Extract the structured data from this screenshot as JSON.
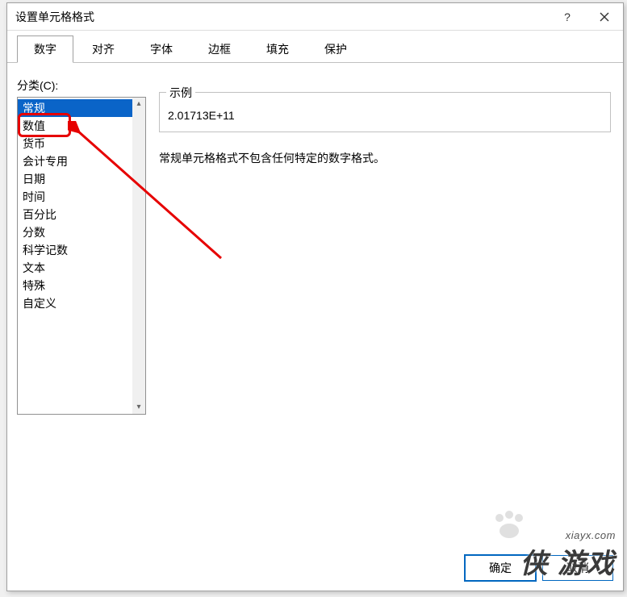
{
  "title": "设置单元格格式",
  "help_glyph": "?",
  "tabs": [
    "数字",
    "对齐",
    "字体",
    "边框",
    "填充",
    "保护"
  ],
  "active_tab_index": 0,
  "category_label": "分类(C):",
  "categories": [
    "常规",
    "数值",
    "货币",
    "会计专用",
    "日期",
    "时间",
    "百分比",
    "分数",
    "科学记数",
    "文本",
    "特殊",
    "自定义"
  ],
  "selected_category_index": 0,
  "highlighted_category_index": 1,
  "sample": {
    "legend": "示例",
    "value": "2.01713E+11"
  },
  "description": "常规单元格格式不包含任何特定的数字格式。",
  "buttons": {
    "ok": "确定",
    "cancel": "取消"
  },
  "watermark": {
    "url": "xiayx.com",
    "brand": "侠 游戏"
  }
}
